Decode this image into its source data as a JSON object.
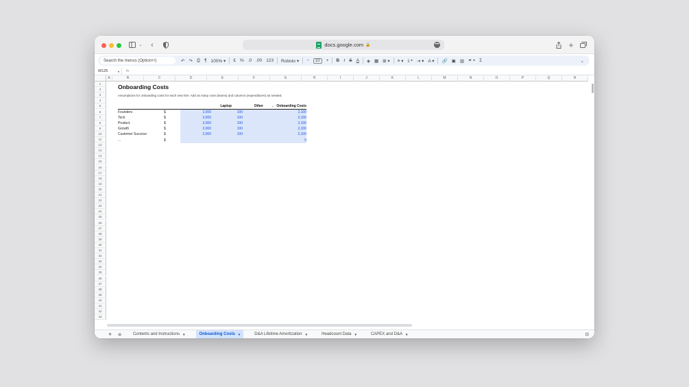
{
  "browser": {
    "url": "docs.google.com"
  },
  "toolbar": {
    "search_placeholder": "Search the menus (Option+/)",
    "zoom": "100%",
    "currency": "£",
    "percent": "%",
    "dec_decrease": ".0",
    "dec_increase": ".00",
    "number_format": "123",
    "font": "Roboto",
    "font_size": "10"
  },
  "formula_bar": {
    "name_box": "W125",
    "fx": "fx"
  },
  "columns": [
    "A",
    "B",
    "C",
    "D",
    "E",
    "F",
    "G",
    "H",
    "I",
    "J",
    "K",
    "L",
    "M",
    "N",
    "O",
    "P",
    "Q",
    "R"
  ],
  "rows": [
    "1",
    "2",
    "3",
    "4",
    "5",
    "6",
    "7",
    "8",
    "9",
    "10",
    "11",
    "12",
    "13",
    "14",
    "15",
    "16",
    "17",
    "18",
    "19",
    "20",
    "21",
    "22",
    "23",
    "24",
    "25",
    "26",
    "27",
    "28",
    "29",
    "30",
    "31",
    "32",
    "33",
    "34",
    "35",
    "36",
    "37",
    "38",
    "39",
    "40",
    "41",
    "42",
    "43"
  ],
  "sheet": {
    "title": "Onboarding Costs",
    "subtitle": "Assumptions for onboarding costs for each new hire. Add as many rows (teams) and columns (expenditures) as needed.",
    "headers": {
      "laptop": "Laptop",
      "other": "Other",
      "total": "Onboarding Costs"
    },
    "table": [
      {
        "team": "Founders",
        "cur": "$",
        "laptop": "2,000",
        "other": "100",
        "total": "2,100"
      },
      {
        "team": "Tech",
        "cur": "$",
        "laptop": "3,000",
        "other": "100",
        "total": "3,100"
      },
      {
        "team": "Product",
        "cur": "$",
        "laptop": "2,000",
        "other": "100",
        "total": "2,100"
      },
      {
        "team": "Growth",
        "cur": "$",
        "laptop": "2,000",
        "other": "100",
        "total": "2,100"
      },
      {
        "team": "Customer Success",
        "cur": "$",
        "laptop": "2,000",
        "other": "100",
        "total": "2,100"
      },
      {
        "team": "...",
        "cur": "$",
        "laptop": "",
        "other": "",
        "total": "0"
      }
    ]
  },
  "sheet_tabs": [
    {
      "label": "Contents and Instructions",
      "active": false
    },
    {
      "label": "Onboarding Costs",
      "active": true
    },
    {
      "label": "D&A Lifetime Amortization",
      "active": false
    },
    {
      "label": "Headcount Data",
      "active": false
    },
    {
      "label": "CAPEX and D&A",
      "active": false
    }
  ]
}
